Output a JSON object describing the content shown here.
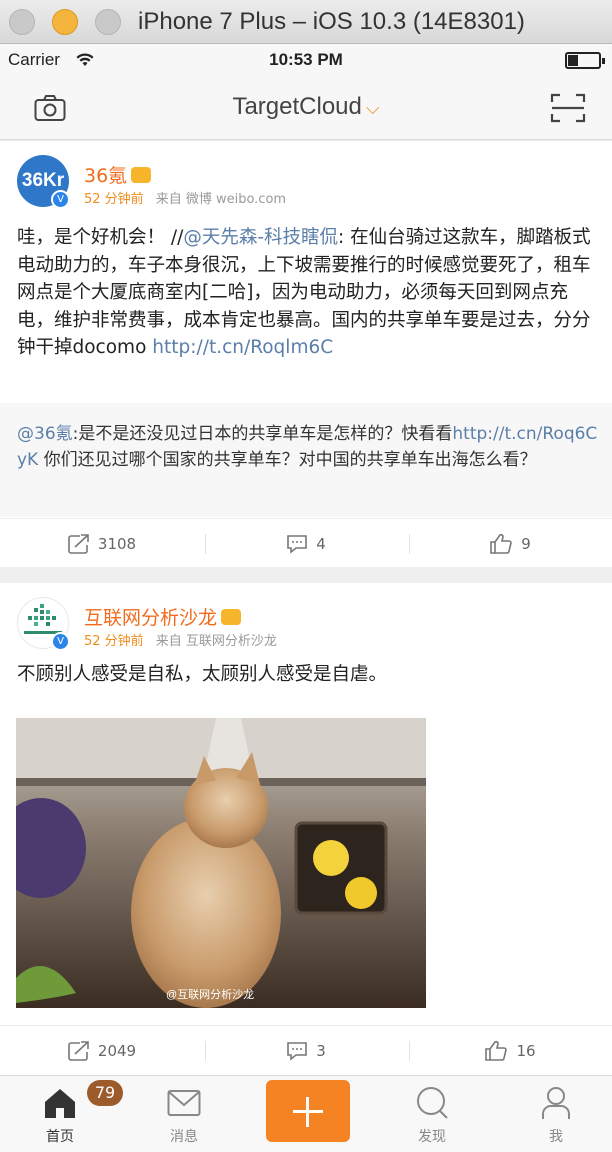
{
  "window": {
    "title": "iPhone 7 Plus – iOS 10.3 (14E8301)"
  },
  "status_bar": {
    "carrier": "Carrier",
    "time": "10:53 PM"
  },
  "nav": {
    "title": "TargetCloud"
  },
  "posts": [
    {
      "avatar_text": "36Kr",
      "name": "36氪",
      "time": "52 分钟前",
      "source": "来自 微博 weibo.com",
      "text_before": "哇，是个好机会！ //",
      "mention": "@天先森-科技瞎侃",
      "text_after": ": 在仙台骑过这款车，脚踏板式电动助力的，车子本身很沉，上下坡需要推行的时候感觉要死了，租车网点是个大厦底商室内[二哈]，因为电动助力，必须每天回到网点充电，维护非常费事，成本肯定也暴高。国内的共享单车要是过去，分分钟干掉docomo ",
      "link": "http://t.cn/Roqlm6C",
      "repost": {
        "mention": "@36氪",
        "text_before": ":是不是还没见过日本的共享单车是怎样的？快看看",
        "link": "http://t.cn/Roq6CyK",
        "text_after": " 你们还见过哪个国家的共享单车？对中国的共享单车出海怎么看？"
      },
      "reposts": "3108",
      "comments": "4",
      "likes": "9"
    },
    {
      "name": "互联网分析沙龙",
      "time": "52 分钟前",
      "source": "来自 互联网分析沙龙",
      "text": "不顾别人感受是自私，太顾别人感受是自虐。",
      "image_watermark": "@互联网分析沙龙",
      "reposts": "2049",
      "comments": "3",
      "likes": "16"
    }
  ],
  "tabs": [
    {
      "label": "首页",
      "badge": "79"
    },
    {
      "label": "消息"
    },
    {
      "label": "发现"
    },
    {
      "label": "我"
    }
  ],
  "colors": {
    "accent": "#f58223",
    "username": "#f26b1d",
    "link": "#5b7fa8"
  }
}
